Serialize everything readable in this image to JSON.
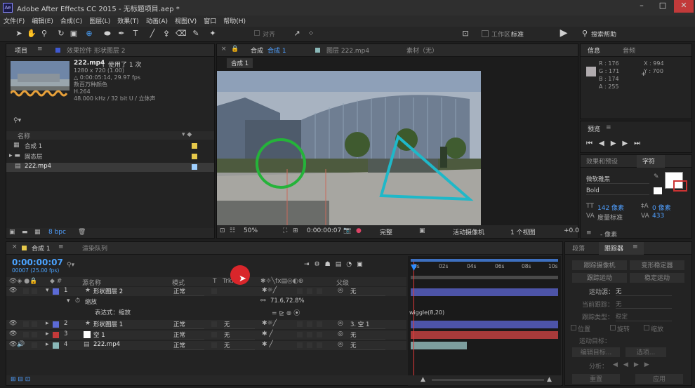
{
  "titlebar": {
    "title": "Adobe After Effects CC 2015 - 无标题项目.aep *",
    "logo": "Ae"
  },
  "menu": [
    "文件(F)",
    "编辑(E)",
    "合成(C)",
    "图层(L)",
    "效果(T)",
    "动画(A)",
    "视图(V)",
    "窗口",
    "帮助(H)"
  ],
  "toolbar": {
    "align_label": "对齐",
    "workspace_label": "工作区:",
    "workspace_value": "标准",
    "search_help": "搜索帮助"
  },
  "project": {
    "tab_project": "项目",
    "tab_effect_controls": "效果控件 形状图层 2",
    "file_name": "222.mp4",
    "used_info": "，使用了 1 次",
    "info_lines": [
      "1280 x 720 (1.00)",
      "△ 0:00:05:14, 29.97 fps",
      "数百万种颜色",
      "H.264",
      "48.000 kHz / 32 bit U / 立体声"
    ],
    "search_icon": "search-icon",
    "col_name": "名称",
    "items": [
      {
        "name": "合成 1",
        "color": "#e6c84a"
      },
      {
        "name": "固态层",
        "color": "#e6c84a"
      },
      {
        "name": "222.mp4",
        "color": "#9fd0ff"
      }
    ],
    "bpc": "8 bpc"
  },
  "comp_viewer": {
    "tab_comp": "合成",
    "tab_comp_name": "合成 1",
    "tab_layer": "图层 222.mp4",
    "tab_footage": "素材（无）",
    "subtab": "合成 1",
    "zoom": "50%",
    "timecode": "0:00:00:07",
    "resolution": "完整",
    "camera": "活动摄像机",
    "views": "1 个视图",
    "offset": "+0.0"
  },
  "info_panel": {
    "tab_info": "信息",
    "tab_audio": "音频",
    "r": "R : 176",
    "g": "G : 171",
    "b": "B : 174",
    "a": "A : 255",
    "x": "X : 994",
    "y": "Y : 700"
  },
  "preview_panel": {
    "tab": "预览"
  },
  "effects_panel": {
    "tab": "效果和预设",
    "tab_char": "字符",
    "font": "微软雅黑",
    "style": "Bold",
    "size": "142 像素",
    "tracking_label": "0 像素",
    "kerning": "度量标准",
    "kern_val": "433",
    "unit": "- 像素"
  },
  "timeline": {
    "tab_comp": "合成 1",
    "tab_render": "渲染队列",
    "timecode": "0:00:00:07",
    "frames": "00007 (25.00 fps)",
    "col_source": "源名称",
    "col_mode": "模式",
    "col_t": "T",
    "col_trkmat": "TrkMat",
    "col_parent": "父级",
    "ruler": [
      "0s",
      "02s",
      "04s",
      "06s",
      "08s",
      "10s"
    ],
    "layers": [
      {
        "num": "1",
        "name": "形状图层 2",
        "mode": "正常",
        "trk": "",
        "parent": "无",
        "color": "#5c6bd6"
      },
      {
        "num": "2",
        "name": "形状图层 1",
        "mode": "正常",
        "trk": "无",
        "parent": "3. 空 1",
        "color": "#5c6bd6"
      },
      {
        "num": "3",
        "name": "空 1",
        "mode": "正常",
        "trk": "无",
        "parent": "无",
        "color": "#c43a3a"
      },
      {
        "num": "4",
        "name": "222.mp4",
        "mode": "正常",
        "trk": "无",
        "parent": "无",
        "color": "#8ab8b8"
      }
    ],
    "scale_label": "缩放",
    "scale_value": "71.6,72.8%",
    "expr_label": "表达式：缩放",
    "expr_text": "wiggle(8,20)"
  },
  "tracker": {
    "tab_paragraph": "段落",
    "tab_tracker": "跟踪器",
    "track_camera": "跟踪摄像机",
    "warp_stab": "变形稳定器",
    "track_motion": "跟踪运动",
    "stabilize": "稳定运动",
    "source_label": "运动源：",
    "source_value": "无",
    "current_track": "当前跟踪：",
    "current_value": "无",
    "track_type": "跟踪类型：",
    "type_value": "稳定",
    "position": "位置",
    "rotation": "旋转",
    "scale": "缩放",
    "target": "运动目标：",
    "edit_target": "编辑目标...",
    "options": "选项...",
    "analyze": "分析：",
    "reset": "重置",
    "apply": "应用"
  },
  "colors": {
    "accent": "#2d8cff",
    "timecode": "#4aa3ff",
    "red_val": "#ff4d4d"
  }
}
